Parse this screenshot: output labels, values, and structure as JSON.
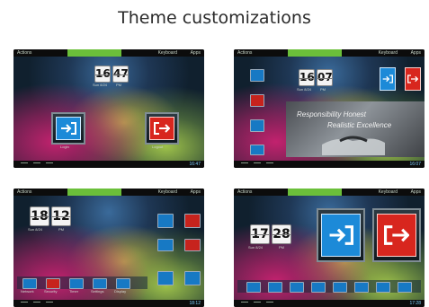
{
  "page": {
    "title": "Theme customizations"
  },
  "statusbar": {
    "home": "Actions",
    "keyboard": "Keyboard",
    "apps": "Apps"
  },
  "panels": [
    {
      "clock": {
        "hour": "16",
        "minute": "47",
        "date_label": "Sun 8/24",
        "ampm_label": "PM"
      },
      "login_label": "Login",
      "logout_label": "Logout",
      "time": "16:47"
    },
    {
      "clock": {
        "hour": "16",
        "minute": "07",
        "date_label": "Sun 8/24",
        "ampm_label": "PM"
      },
      "banner": {
        "line1": "Responsibility  Honest",
        "line2": "Realistic  Excellence"
      },
      "time": "16:07"
    },
    {
      "clock": {
        "hour": "18",
        "minute": "12",
        "date_label": "Sun 8/24",
        "ampm_label": "PM"
      },
      "dock_labels": [
        "Network",
        "Security",
        "Timer",
        "Settings",
        "Display"
      ],
      "time": "18:12"
    },
    {
      "clock": {
        "hour": "17",
        "minute": "28",
        "date_label": "Sun 8/24",
        "ampm_label": "PM"
      },
      "time": "17:28"
    }
  ],
  "colors": {
    "accent_green": "#6bbf3a",
    "login_blue": "#1c8ad8",
    "logout_red": "#d8261e"
  }
}
